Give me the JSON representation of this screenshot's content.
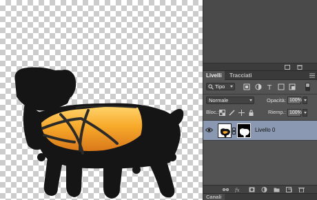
{
  "layers_panel": {
    "tabs": [
      {
        "label": "Livelli",
        "active": true
      },
      {
        "label": "Tracciati",
        "active": false
      }
    ],
    "filter": {
      "label": "Tipo"
    },
    "blend_mode": "Normale",
    "opacity": {
      "label": "Opacità:",
      "value": "100%"
    },
    "lock": {
      "label": "Bloc.:"
    },
    "fill": {
      "label": "Riemp.:",
      "value": "100%"
    },
    "layers": [
      {
        "name": "Livello 0",
        "visible": true,
        "selected": true,
        "has_mask": true
      }
    ]
  },
  "channels_panel": {
    "tab_label": "Canali"
  },
  "colors": {
    "selected_layer": "#8a99b1",
    "panel_bg": "#535353",
    "vest_orange": "#f5a623",
    "dog_black": "#151515"
  }
}
